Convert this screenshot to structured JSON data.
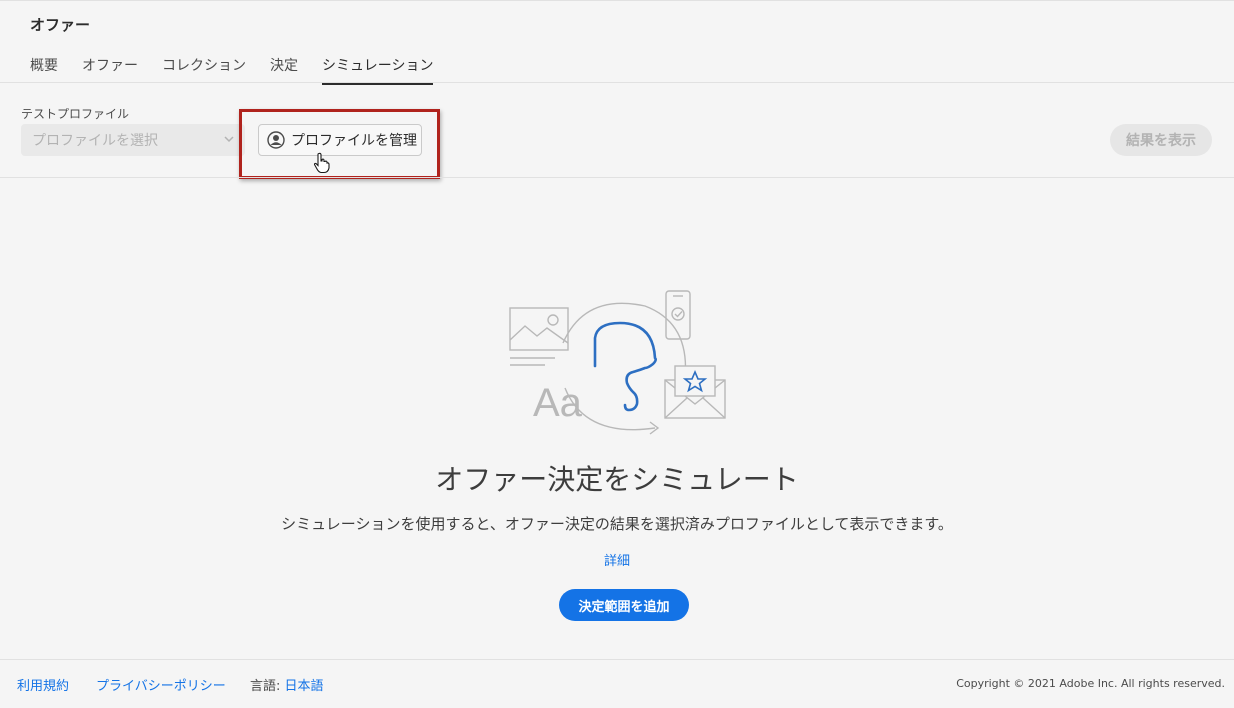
{
  "header": {
    "title": "オファー",
    "tabs": [
      {
        "label": "概要"
      },
      {
        "label": "オファー"
      },
      {
        "label": "コレクション"
      },
      {
        "label": "決定"
      },
      {
        "label": "シミュレーション"
      }
    ],
    "active_tab": "シミュレーション"
  },
  "toolbar": {
    "profile_label": "テストプロファイル",
    "profile_placeholder": "プロファイルを選択",
    "manage_profiles_label": "プロファイルを管理",
    "view_results_label": "結果を表示"
  },
  "empty_state": {
    "title": "オファー決定をシミュレート",
    "description": "シミュレーションを使用すると、オファー決定の結果を選択済みプロファイルとして表示できます。",
    "more_link": "詳細",
    "add_scope_button": "決定範囲を追加",
    "illustration_text": "Aa"
  },
  "footer": {
    "terms": "利用規約",
    "privacy": "プライバシーポリシー",
    "language_label": "言語: ",
    "language_value": "日本語",
    "copyright": "Copyright ©  2021 Adobe Inc.  All rights reserved."
  },
  "colors": {
    "accent": "#1473e6",
    "highlight": "#b0231d",
    "background": "#f5f5f5"
  },
  "icons": [
    "chevron-down-icon",
    "user-icon",
    "hand-pointer-icon"
  ]
}
